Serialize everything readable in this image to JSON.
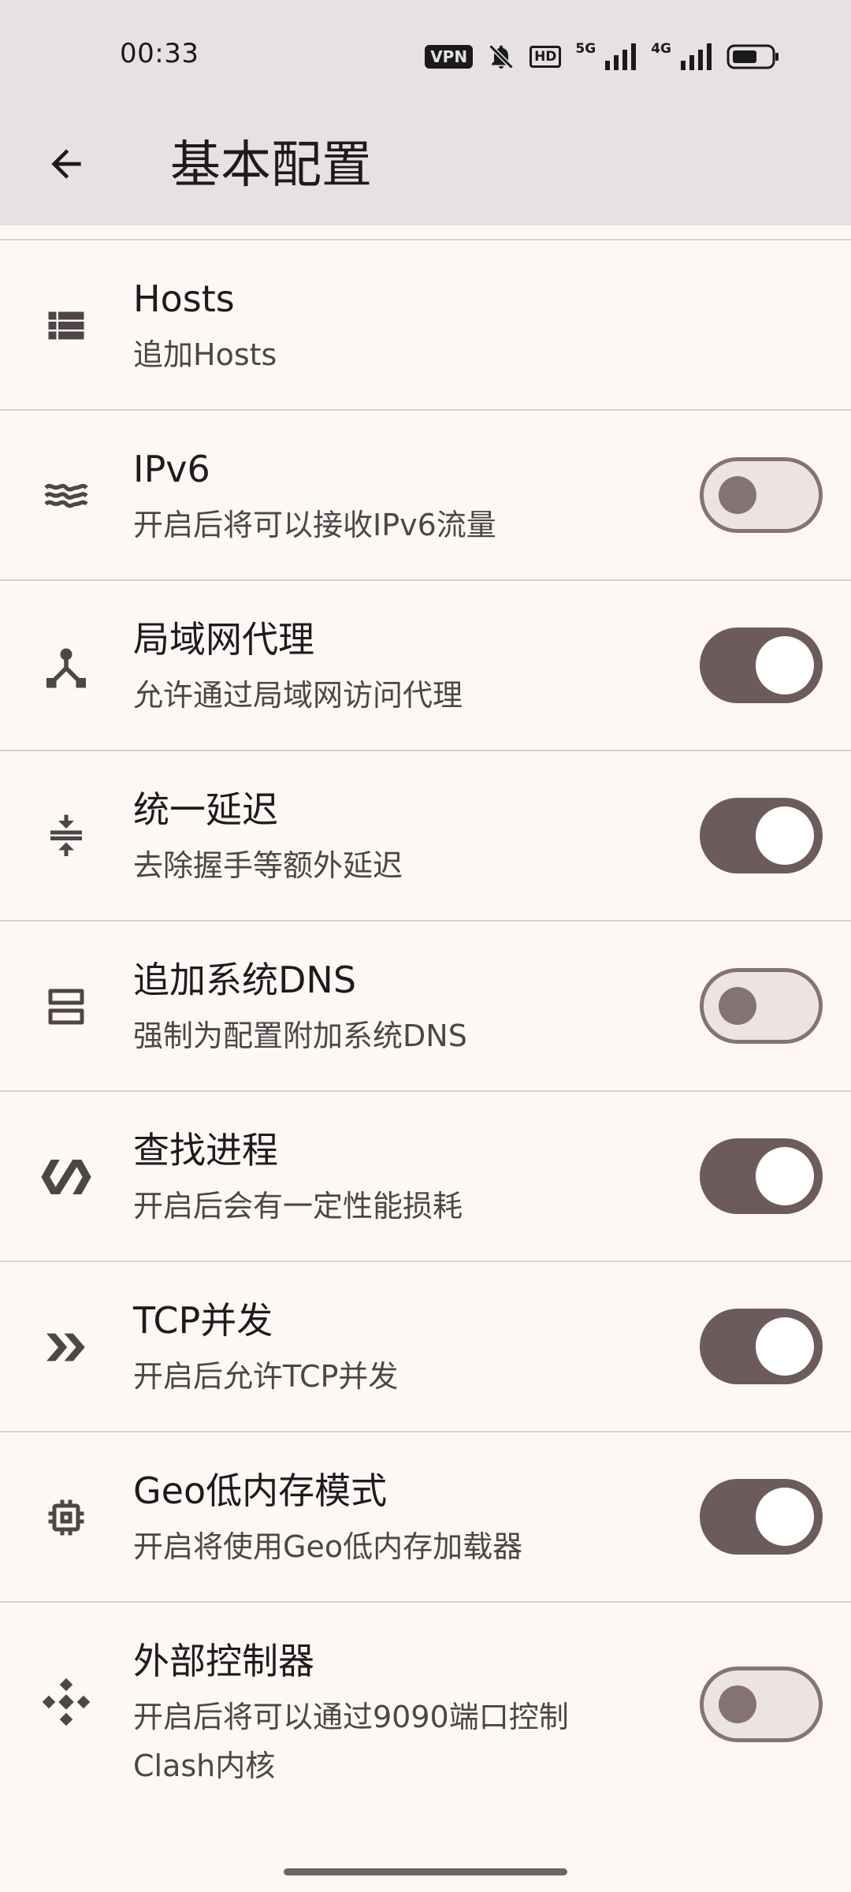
{
  "status_bar": {
    "time": "00:33",
    "vpn": "VPN",
    "hd": "HD",
    "net1": "5G",
    "net2": "4G",
    "icons": [
      "vpn-badge",
      "bell-off-icon",
      "hd-icon",
      "signal-5g-icon",
      "signal-4g-icon",
      "battery-icon"
    ]
  },
  "app_bar": {
    "back_icon": "arrow-back-icon",
    "title": "基本配置"
  },
  "settings": [
    {
      "id": "hosts",
      "icon": "list-icon",
      "title": "Hosts",
      "subtitle": "追加Hosts",
      "toggle": null
    },
    {
      "id": "ipv6",
      "icon": "waves-icon",
      "title": "IPv6",
      "subtitle": "开启后将可以接收IPv6流量",
      "toggle": false
    },
    {
      "id": "lan-proxy",
      "icon": "hub-icon",
      "title": "局域网代理",
      "subtitle": "允许通过局域网访问代理",
      "toggle": true
    },
    {
      "id": "unified-delay",
      "icon": "compress-icon",
      "title": "统一延迟",
      "subtitle": "去除握手等额外延迟",
      "toggle": true
    },
    {
      "id": "system-dns",
      "icon": "dns-icon",
      "title": "追加系统DNS",
      "subtitle": "强制为配置附加系统DNS",
      "toggle": false
    },
    {
      "id": "find-process",
      "icon": "polymer-icon",
      "title": "查找进程",
      "subtitle": "开启后会有一定性能损耗",
      "toggle": true
    },
    {
      "id": "tcp-concurrent",
      "icon": "double-chevron-icon",
      "title": "TCP并发",
      "subtitle": "开启后允许TCP并发",
      "toggle": true
    },
    {
      "id": "geo-low-memory",
      "icon": "memory-chip-icon",
      "title": "Geo低内存模式",
      "subtitle": "开启将使用Geo低内存加载器",
      "toggle": true
    },
    {
      "id": "external-controller",
      "icon": "control-diamond-icon",
      "title": "外部控制器",
      "subtitle": "开启后将可以通过9090端口控制Clash内核",
      "toggle": false
    }
  ]
}
